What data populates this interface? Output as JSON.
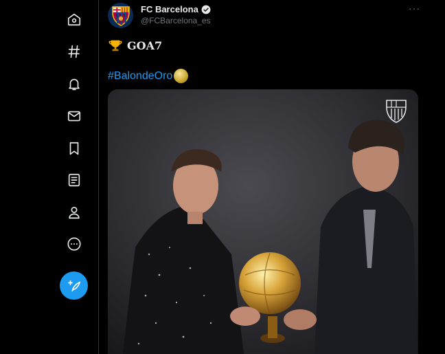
{
  "sidebar": {
    "items": [
      {
        "icon": "home-icon",
        "label": "Home"
      },
      {
        "icon": "hashtag-icon",
        "label": "Explore"
      },
      {
        "icon": "bell-icon",
        "label": "Notifications"
      },
      {
        "icon": "mail-icon",
        "label": "Messages"
      },
      {
        "icon": "bookmark-icon",
        "label": "Bookmarks"
      },
      {
        "icon": "list-icon",
        "label": "Lists"
      },
      {
        "icon": "profile-icon",
        "label": "Profile"
      },
      {
        "icon": "more-circle-icon",
        "label": "More"
      }
    ],
    "compose_icon": "compose-tweet-icon"
  },
  "tweet": {
    "author_name": "FC Barcelona",
    "author_handle": "@FCBarcelona_es",
    "text_line1": "GOA7",
    "text_line1_emoji": "trophy-icon",
    "hashtag": "#BalondeOro",
    "hashtag_emoji": "ballon-dor-icon",
    "more_label": "···"
  },
  "colors": {
    "background": "#000000",
    "accent": "#1d9bf0",
    "text_primary": "#e7e9ea",
    "text_secondary": "#71767b",
    "divider": "#2f3336"
  }
}
